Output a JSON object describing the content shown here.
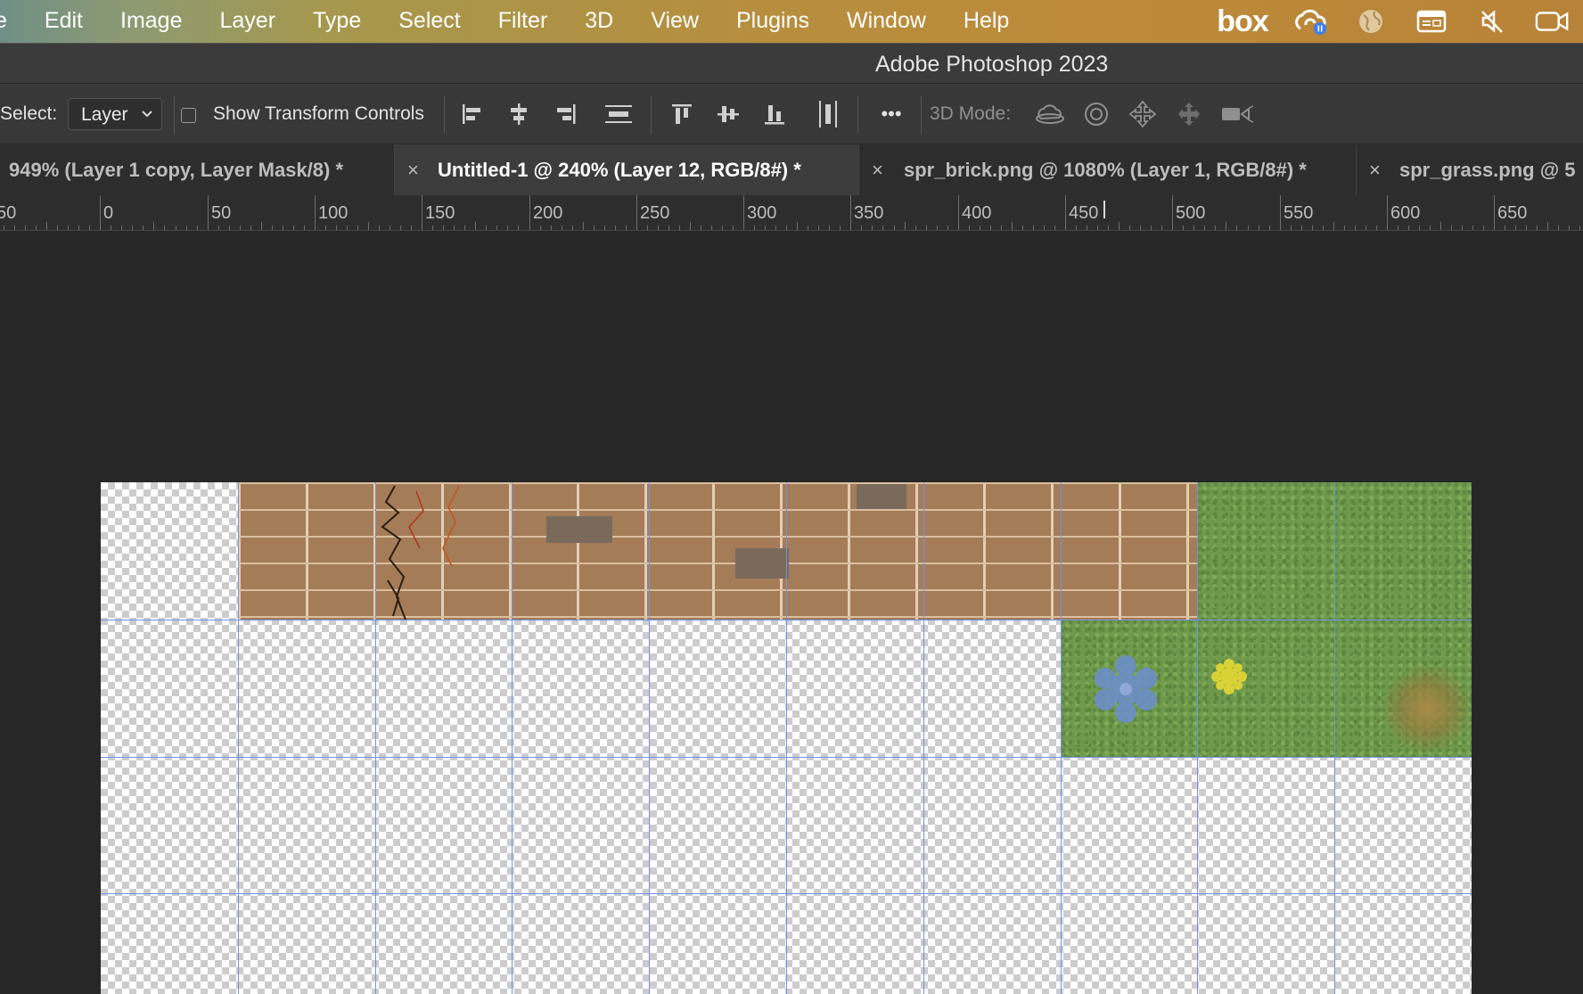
{
  "menubar": {
    "items": [
      "e",
      "Edit",
      "Image",
      "Layer",
      "Type",
      "Select",
      "Filter",
      "3D",
      "View",
      "Plugins",
      "Window",
      "Help"
    ],
    "status_icons": [
      "box-logo",
      "creative-cloud-icon",
      "globe-icon",
      "calendar-icon",
      "mute-icon",
      "camera-icon"
    ],
    "box_label": "box"
  },
  "titlebar": {
    "title": "Adobe Photoshop 2023"
  },
  "options": {
    "select_label": "Select:",
    "select_value": "Layer",
    "transform_label": "Show Transform Controls",
    "transform_checked": false,
    "mode3d_label": "3D Mode:",
    "more_label": "•••"
  },
  "tabs": [
    {
      "label": "949% (Layer 1 copy, Layer Mask/8) *",
      "close": "",
      "active": false
    },
    {
      "label": "Untitled-1 @ 240% (Layer 12, RGB/8#) *",
      "close": "×",
      "active": true
    },
    {
      "label": "spr_brick.png @ 1080% (Layer 1, RGB/8#) *",
      "close": "×",
      "active": false
    },
    {
      "label": "spr_grass.png @ 5",
      "close": "×",
      "active": false
    }
  ],
  "ruler": {
    "labels": [
      "50",
      "0",
      "50",
      "100",
      "150",
      "200",
      "250",
      "300",
      "350",
      "400",
      "450",
      "500",
      "550",
      "600",
      "650"
    ]
  },
  "colors": {
    "guide": "#6f93e6",
    "brick": "#a47c58",
    "grass": "#6f9a4d",
    "flower_blue": "#6c8fc8",
    "flower_yellow": "#d9d236"
  }
}
